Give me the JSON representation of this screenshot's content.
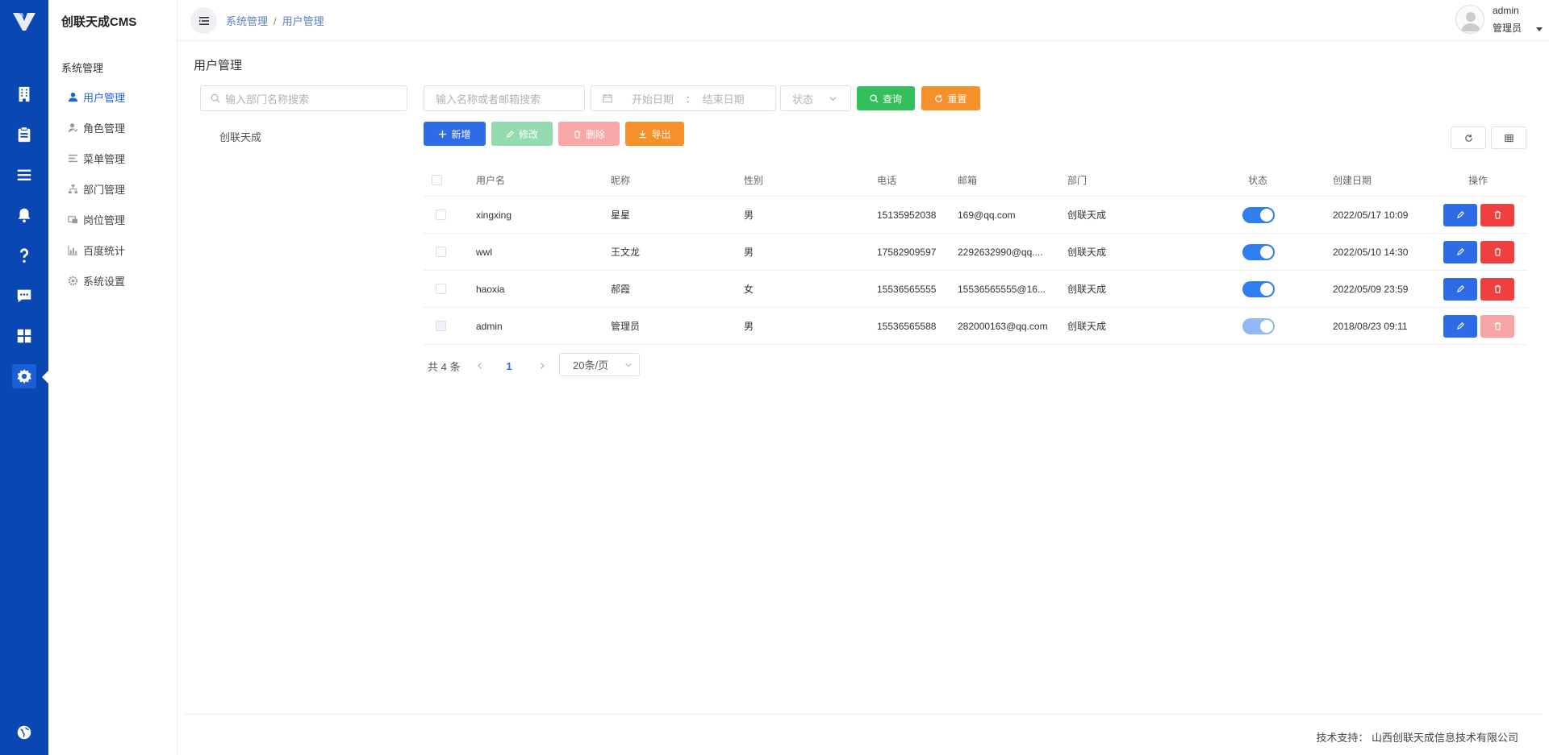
{
  "app": {
    "brand": "创联天成CMS"
  },
  "rail": {
    "icons": [
      "logo-icon",
      "building-icon",
      "clipboard-icon",
      "list-icon",
      "bell-icon",
      "help-icon",
      "chat-icon",
      "grid-icon",
      "gear-icon",
      "globe-icon"
    ]
  },
  "subnav": {
    "group": "系统管理",
    "items": [
      {
        "label": "用户管理",
        "icon": "user-icon",
        "active": true
      },
      {
        "label": "角色管理",
        "icon": "role-icon"
      },
      {
        "label": "菜单管理",
        "icon": "menu-icon"
      },
      {
        "label": "部门管理",
        "icon": "org-icon"
      },
      {
        "label": "岗位管理",
        "icon": "post-icon"
      },
      {
        "label": "百度统计",
        "icon": "chart-icon"
      },
      {
        "label": "系统设置",
        "icon": "gear-icon"
      }
    ]
  },
  "header": {
    "breadcrumb": [
      "系统管理",
      "用户管理"
    ],
    "breadcrumb_sep": "/",
    "user": {
      "name": "admin",
      "role": "管理员"
    }
  },
  "page": {
    "title": "用户管理"
  },
  "dept": {
    "search_placeholder": "输入部门名称搜索",
    "tree": [
      "创联天成"
    ]
  },
  "filters": {
    "keyword_placeholder": "输入名称或者邮箱搜索",
    "date_start_placeholder": "开始日期",
    "date_sep": ":",
    "date_end_placeholder": "结束日期",
    "status_placeholder": "状态",
    "query_label": "查询",
    "reset_label": "重置"
  },
  "toolbar": {
    "add_label": "新增",
    "edit_label": "修改",
    "delete_label": "删除",
    "export_label": "导出"
  },
  "table": {
    "columns": [
      "用户名",
      "昵称",
      "性别",
      "电话",
      "邮箱",
      "部门",
      "状态",
      "创建日期",
      "操作"
    ],
    "rows": [
      {
        "username": "xingxing",
        "nickname": "星星",
        "gender": "男",
        "phone": "15135952038",
        "email": "169@qq.com",
        "dept": "创联天成",
        "enabled": true,
        "created": "2022/05/17 10:09",
        "locked": false
      },
      {
        "username": "wwl",
        "nickname": "王文龙",
        "gender": "男",
        "phone": "17582909597",
        "email": "2292632990@qq....",
        "dept": "创联天成",
        "enabled": true,
        "created": "2022/05/10 14:30",
        "locked": false
      },
      {
        "username": "haoxia",
        "nickname": "郝霞",
        "gender": "女",
        "phone": "15536565555",
        "email": "15536565555@16...",
        "dept": "创联天成",
        "enabled": true,
        "created": "2022/05/09 23:59",
        "locked": false
      },
      {
        "username": "admin",
        "nickname": "管理员",
        "gender": "男",
        "phone": "15536565588",
        "email": "282000163@qq.com",
        "dept": "创联天成",
        "enabled": true,
        "created": "2018/08/23 09:11",
        "locked": true
      }
    ]
  },
  "pagination": {
    "total_text": "共 4 条",
    "current_page": "1",
    "page_size": "20条/页"
  },
  "footer": {
    "text": "技术支持：  山西创联天成信息技术有限公司"
  },
  "colors": {
    "rail_bg": "#0b47b3",
    "primary": "#2e6be6",
    "success": "#33c05b",
    "warning": "#f5902b",
    "danger": "#ef3f3f"
  }
}
